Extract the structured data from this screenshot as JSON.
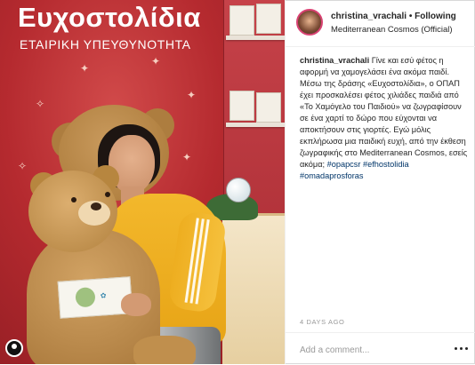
{
  "photo": {
    "brand_title": "Ευχοστολίδια",
    "brand_subtitle": "ΕΤΑΙΡΙΚΗ ΥΠΕΥΘΥΝΟΤΗΤΑ"
  },
  "post": {
    "username": "christina_vrachali",
    "separator": "•",
    "follow_status": "Following",
    "location": "Mediterranean Cosmos (Official)",
    "caption_user": "christina_vrachali",
    "caption_text": "Γίνε και εσύ φέτος η αφορμή να χαμογελάσει ένα ακόμα παιδί. Μέσω της δράσης «Ευχοστολίδια», ο ΟΠΑΠ έχει προσκαλέσει φέτος χιλιάδες παιδιά από «Το Χαμόγελο του Παιδιού» να ζωγραφίσουν σε ένα χαρτί το δώρο που εύχονται να αποκτήσουν στις γιορτές. Εγώ μόλις εκπλήρωσα μια παιδική ευχή, από την έκθεση ζωγραφικής στο Mediterranean Cosmos, εσείς ακόμα;",
    "hashtags": [
      "#opapcsr",
      "#efhostolidia",
      "#omadaprosforas"
    ],
    "age": "4 DAYS AGO"
  },
  "comment": {
    "placeholder": "Add a comment..."
  }
}
